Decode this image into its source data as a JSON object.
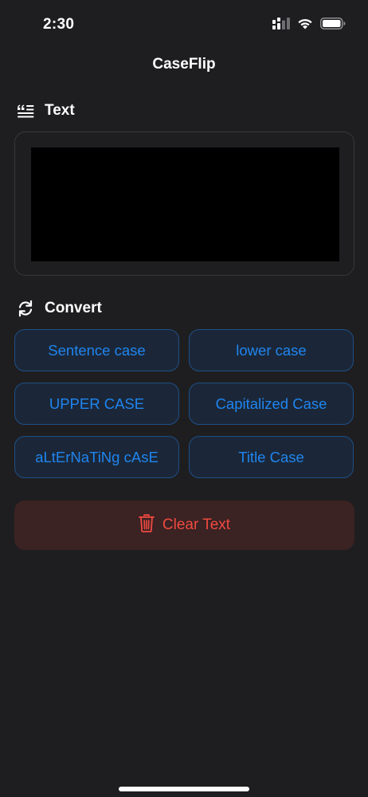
{
  "status_bar": {
    "time": "2:30",
    "icons": [
      "cellular-signal-icon",
      "wifi-icon",
      "battery-icon"
    ]
  },
  "nav": {
    "title": "CaseFlip"
  },
  "text_section": {
    "header": "Text",
    "icon": "text-quote-icon",
    "input_value": ""
  },
  "convert_section": {
    "header": "Convert",
    "icon": "refresh-arrows-icon",
    "buttons": [
      "Sentence case",
      "lower case",
      "UPPER CASE",
      "Capitalized Case",
      "aLtErNaTiNg cAsE",
      "Title Case"
    ]
  },
  "clear": {
    "label": "Clear Text",
    "icon": "trash-icon"
  },
  "colors": {
    "background": "#1e1e20",
    "accent_blue": "#1f85f0",
    "button_blue_bg": "#1b2738",
    "button_blue_border": "#1e4f86",
    "destructive_red": "#ef4a40",
    "destructive_bg": "#3b2223",
    "text_area_bg": "#000000"
  }
}
